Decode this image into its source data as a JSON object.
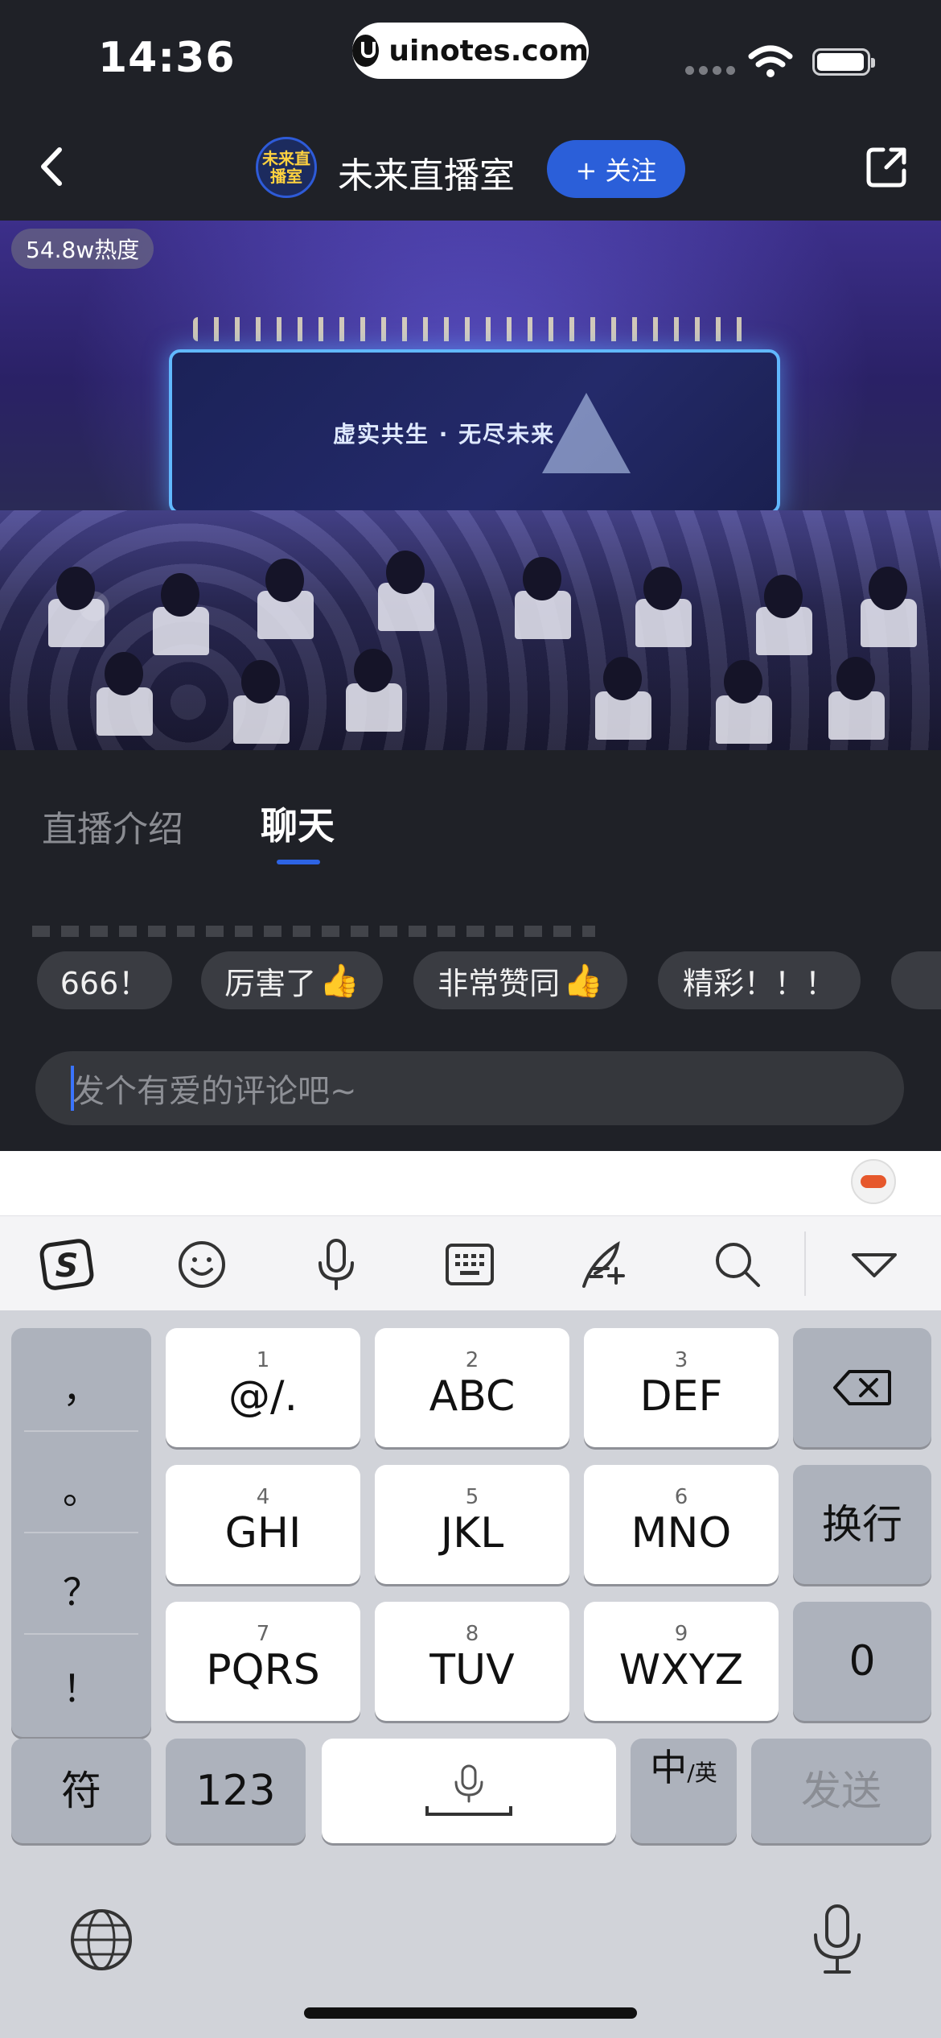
{
  "status_bar": {
    "time": "14:36",
    "watermark": "uinotes.com"
  },
  "header": {
    "channel_title": "未来直播室",
    "avatar_text": "未来直播室",
    "follow_label": "+ 关注"
  },
  "video": {
    "heat": "54.8w热度",
    "screen_text": "虚实共生 · 无尽未来"
  },
  "tabs": [
    {
      "label": "直播介绍",
      "active": false
    },
    {
      "label": "聊天",
      "active": true
    }
  ],
  "quick_replies": [
    "666！",
    "厉害了",
    "非常赞同",
    "精彩！！！"
  ],
  "quick_reply_emoji": "👍",
  "comment": {
    "placeholder": "发个有爱的评论吧~"
  },
  "keyboard": {
    "toolbar_icons": [
      "sogou-logo-icon",
      "emoji-icon",
      "microphone-icon",
      "keyboard-icon",
      "quill-icon",
      "search-icon",
      "collapse-icon"
    ],
    "punctuation": [
      "，",
      "。",
      "？",
      "！"
    ],
    "keys": [
      {
        "num": "1",
        "label": "@/."
      },
      {
        "num": "2",
        "label": "ABC"
      },
      {
        "num": "3",
        "label": "DEF"
      },
      {
        "num": "4",
        "label": "GHI"
      },
      {
        "num": "5",
        "label": "JKL"
      },
      {
        "num": "6",
        "label": "MNO"
      },
      {
        "num": "7",
        "label": "PQRS"
      },
      {
        "num": "8",
        "label": "TUV"
      },
      {
        "num": "9",
        "label": "WXYZ"
      }
    ],
    "newline_label": "换行",
    "zero_label": "0",
    "symbols_label": "符",
    "numbers_label": "123",
    "lang_main": "中",
    "lang_sub": "/英",
    "send_label": "发送"
  },
  "colors": {
    "accent": "#2b5fd9",
    "background": "#1f2127",
    "keyboard_bg": "#d1d3d9"
  }
}
